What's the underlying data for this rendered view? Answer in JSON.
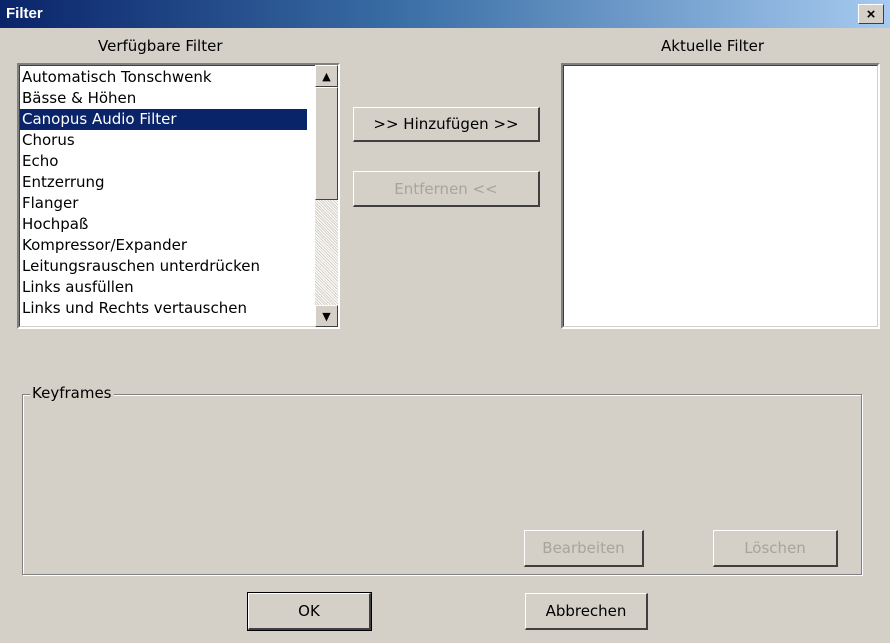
{
  "window": {
    "title": "Filter",
    "close_glyph": "×"
  },
  "available": {
    "label": "Verfügbare Filter",
    "items": [
      "Automatisch Tonschwenk",
      "Bässe & Höhen",
      "Canopus Audio Filter",
      "Chorus",
      "Echo",
      "Entzerrung",
      "Flanger",
      "Hochpaß",
      "Kompressor/Expander",
      "Leitungsrauschen unterdrücken",
      "Links ausfüllen",
      "Links und Rechts vertauschen"
    ],
    "selected_index": 2
  },
  "current": {
    "label": "Aktuelle Filter",
    "items": []
  },
  "buttons": {
    "add": ">> Hinzufügen >>",
    "remove": "Entfernen <<",
    "edit": "Bearbeiten",
    "delete": "Löschen",
    "ok": "OK",
    "cancel": "Abbrechen"
  },
  "keyframes": {
    "label": "Keyframes"
  },
  "icons": {
    "scroll_up": "▲",
    "scroll_down": "▼"
  }
}
